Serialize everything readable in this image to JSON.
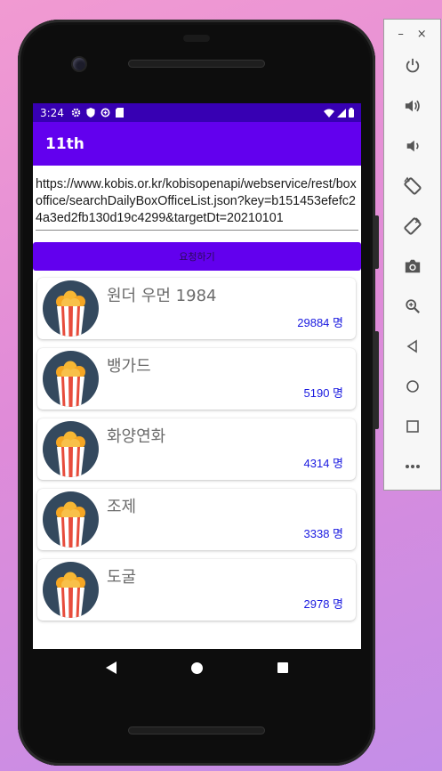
{
  "status_bar": {
    "time": "3:24"
  },
  "app_bar": {
    "title": "11th"
  },
  "url_input": {
    "value": "https://www.kobis.or.kr/kobisopenapi/webservice/rest/boxoffice/searchDailyBoxOfficeList.json?key=b151453efefc24a3ed2fb130d19c4299&targetDt=20210101"
  },
  "request_button": {
    "label": "요청하기"
  },
  "movies": [
    {
      "title": "원더 우먼 1984",
      "audience": "29884 명"
    },
    {
      "title": "뱅가드",
      "audience": "5190 명"
    },
    {
      "title": "화양연화",
      "audience": "4314 명"
    },
    {
      "title": "조제",
      "audience": "3338 명"
    },
    {
      "title": "도굴",
      "audience": "2978 명"
    }
  ],
  "colors": {
    "primary": "#6200ee",
    "status_bar": "#3700b3",
    "audience_text": "#1a1ae0",
    "poster_bg": "#34495e"
  },
  "emulator_toolbar": {
    "window_controls": [
      "minimize-icon",
      "close-icon"
    ],
    "buttons": [
      "power-icon",
      "volume-up-icon",
      "volume-down-icon",
      "rotate-left-icon",
      "rotate-right-icon",
      "camera-icon",
      "zoom-icon",
      "back-icon",
      "home-icon",
      "overview-icon",
      "more-icon"
    ]
  }
}
